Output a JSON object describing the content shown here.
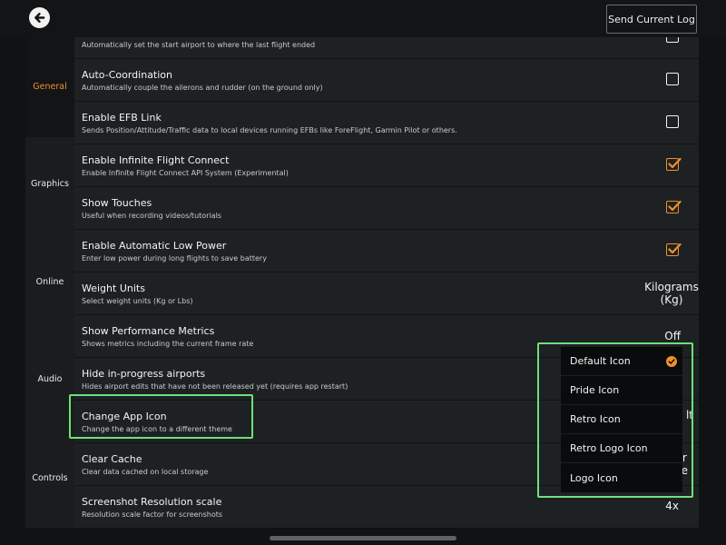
{
  "header": {
    "send_log_label": "Send Current Log"
  },
  "sidebar": {
    "tabs": [
      {
        "label": "General",
        "active": true
      },
      {
        "label": "Graphics"
      },
      {
        "label": "Online"
      },
      {
        "label": "Audio"
      },
      {
        "label": "Controls"
      }
    ]
  },
  "settings": {
    "rows": [
      {
        "title": "",
        "subtitle": "Automatically set the start airport to where the last flight ended",
        "checked": false
      },
      {
        "title": "Auto-Coordination",
        "subtitle": "Automatically couple the ailerons and rudder (on the ground only)",
        "checked": false
      },
      {
        "title": "Enable EFB Link",
        "subtitle": "Sends Position/Attitude/Traffic data to local devices running EFBs like ForeFlight, Garmin Pilot or others.",
        "checked": false
      },
      {
        "title": "Enable Infinite Flight Connect",
        "subtitle": "Enable Infinite Flight Connect API System (Experimental)",
        "checked": true
      },
      {
        "title": "Show Touches",
        "subtitle": "Useful when recording videos/tutorials",
        "checked": true
      },
      {
        "title": "Enable Automatic Low Power",
        "subtitle": "Enter low power during long flights to save battery",
        "checked": true
      },
      {
        "title": "Weight Units",
        "subtitle": "Select weight units (Kg or Lbs)",
        "value_line1": "Kilograms",
        "value_line2": "(Kg)"
      },
      {
        "title": "Show Performance Metrics",
        "subtitle": "Shows metrics including the current frame rate",
        "value_line1": "Off"
      },
      {
        "title": "Hide in-progress airports",
        "subtitle": "Hides airport edits that have not been released yet (requires app restart)"
      },
      {
        "title": "Change App Icon",
        "subtitle": "Change the app icon to a different theme",
        "value_line1": "lt"
      },
      {
        "title": "Clear Cache",
        "subtitle": "Clear data cached on local storage",
        "value_line1": "r",
        "value_line2": "e"
      },
      {
        "title": "Screenshot Resolution scale",
        "subtitle": "Resolution scale factor for screenshots",
        "value_line1": "4x"
      }
    ]
  },
  "icon_dropdown": {
    "options": [
      {
        "label": "Default Icon",
        "selected": true
      },
      {
        "label": "Pride Icon"
      },
      {
        "label": "Retro Icon"
      },
      {
        "label": "Retro Logo Icon"
      },
      {
        "label": "Logo Icon"
      }
    ]
  },
  "colors": {
    "accent": "#f0902a",
    "highlight": "#6ee07a",
    "background": "#101214",
    "row": "#1e2123"
  },
  "icons": {
    "back": "arrow-left-circle-icon",
    "check": "checkmark-icon"
  }
}
